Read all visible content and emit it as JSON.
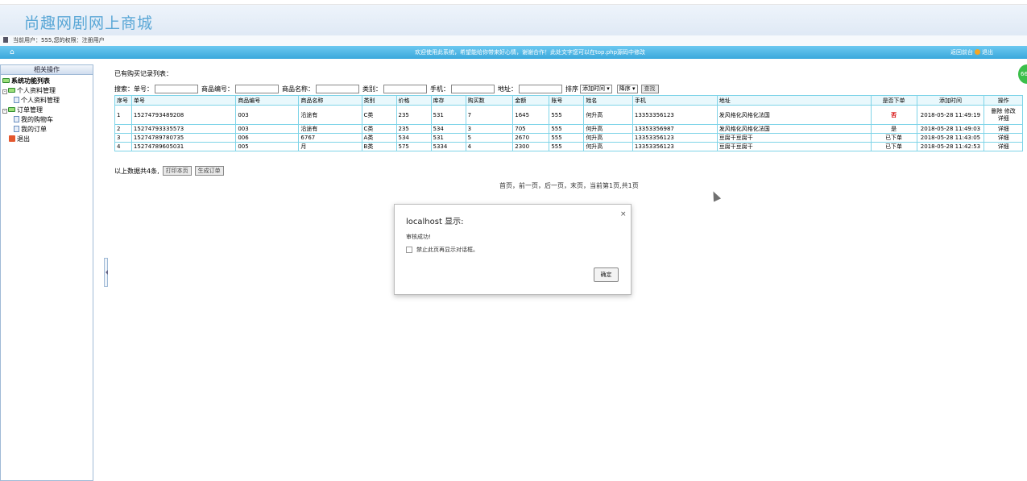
{
  "header": {
    "title": "尚趣网剧网上商城"
  },
  "userbar": {
    "text": "当前用户：555,您的权限：注册用户"
  },
  "bluebar": {
    "home_icon": "⌂",
    "welcome": "欢迎使用此系统，希望能给你带来好心情，谢谢合作！此处文字您可以在top.php源码中修改",
    "back_label": "返回前台",
    "exit_label": "退出"
  },
  "badge": {
    "text": "66"
  },
  "sidebar": {
    "header": "相关操作",
    "root": "系统功能列表",
    "group1": "个人资料管理",
    "group1_item1": "个人资料管理",
    "group2": "订单管理",
    "group2_item1": "我的购物车",
    "group2_item2": "我的订单",
    "exit": "退出"
  },
  "main": {
    "record_label": "已有购买记录列表：",
    "search": {
      "label": "搜索：",
      "f1": "单号：",
      "f2": "商品编号：",
      "f3": "商品名称：",
      "f4": "类别：",
      "f5": "手机：",
      "f6": "地址：",
      "sort_label": "排序",
      "sort_field": "添加时间 ▾",
      "sort_order": "降序 ▾",
      "search_button": "查找"
    },
    "table": {
      "headers": [
        "序号",
        "单号",
        "商品编号",
        "商品名称",
        "类别",
        "价格",
        "库存",
        "购买数",
        "金额",
        "账号",
        "姓名",
        "手机",
        "地址",
        "是否下单",
        "添加时间",
        "操作"
      ],
      "rows": [
        [
          "1",
          "15274793489208",
          "003",
          "沿途有",
          "C类",
          "235",
          "531",
          "7",
          "1645",
          "555",
          "何升高",
          "13353356123",
          "发风格化风格化法国",
          "否",
          "2018-05-28 11:49:19",
          "删除 修改 详细"
        ],
        [
          "2",
          "15274793335573",
          "003",
          "沿途有",
          "C类",
          "235",
          "534",
          "3",
          "705",
          "555",
          "何升高",
          "13353356987",
          "发风格化风格化法国",
          "是",
          "2018-05-28 11:49:03",
          "详细"
        ],
        [
          "3",
          "15274789780735",
          "006",
          "6767",
          "A类",
          "534",
          "531",
          "5",
          "2670",
          "555",
          "何升高",
          "13353356123",
          "豆腐干豆腐干",
          "已下单",
          "2018-05-28 11:43:05",
          "详细"
        ],
        [
          "4",
          "15274789605031",
          "005",
          "月",
          "B类",
          "575",
          "5334",
          "4",
          "2300",
          "555",
          "何升高",
          "13353356123",
          "豆腐干豆腐干",
          "已下单",
          "2018-05-28 11:42:53",
          "详细"
        ]
      ],
      "row1_ops": {
        "delete": "删除",
        "edit": "修改",
        "detail": "详细"
      }
    },
    "summary": "以上数据共4条,",
    "print_button": "打印本页",
    "generate_button": "生成订单",
    "pager": "首页，前一页，后一页，末页，当前第1页,共1页"
  },
  "dialog": {
    "title": "localhost 显示:",
    "close": "×",
    "message": "审核成功!",
    "checkbox_label": "禁止此页再显示对话框。",
    "ok_button": "确定"
  }
}
